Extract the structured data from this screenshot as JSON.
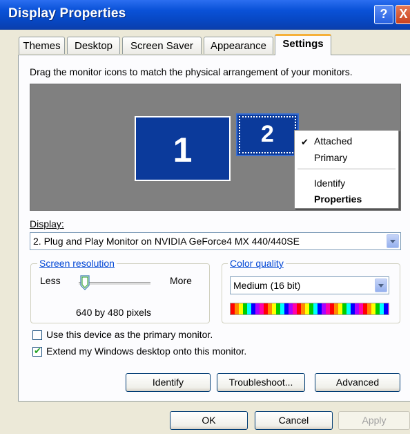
{
  "window": {
    "title": "Display Properties",
    "help_label": "?",
    "close_label": "X",
    "title_color": "#0a52d8"
  },
  "tabs": [
    {
      "label": "Themes"
    },
    {
      "label": "Desktop"
    },
    {
      "label": "Screen Saver"
    },
    {
      "label": "Appearance"
    },
    {
      "label": "Settings",
      "active": true
    }
  ],
  "settings": {
    "instruction": "Drag the monitor icons to match the physical arrangement of your monitors.",
    "monitors": [
      {
        "number": "1"
      },
      {
        "number": "2",
        "selected": true
      }
    ],
    "context_menu": {
      "items": [
        {
          "label": "Attached",
          "checked": true
        },
        {
          "label": "Primary"
        },
        {
          "label": "Identify"
        },
        {
          "label": "Properties",
          "bold": true
        }
      ]
    },
    "display_label": "Display:",
    "display_value": "2. Plug and Play Monitor on NVIDIA GeForce4 MX 440/440SE",
    "screen_resolution": {
      "legend": "Screen resolution",
      "less": "Less",
      "more": "More",
      "value": "640 by 480 pixels",
      "slider_fraction": 0.0
    },
    "color_quality": {
      "legend": "Color quality",
      "value": "Medium (16 bit)"
    },
    "checkboxes": [
      {
        "label": "Use this device as the primary monitor.",
        "checked": false
      },
      {
        "label": "Extend my Windows desktop onto this monitor.",
        "checked": true
      }
    ],
    "buttons": {
      "identify": "Identify",
      "troubleshoot": "Troubleshoot...",
      "advanced": "Advanced"
    }
  },
  "dialog_buttons": {
    "ok": "OK",
    "cancel": "Cancel",
    "apply": "Apply"
  },
  "icons": [
    "help-icon",
    "close-icon",
    "checkmark-icon",
    "dropdown-arrow-icon",
    "slider-thumb-icon"
  ]
}
